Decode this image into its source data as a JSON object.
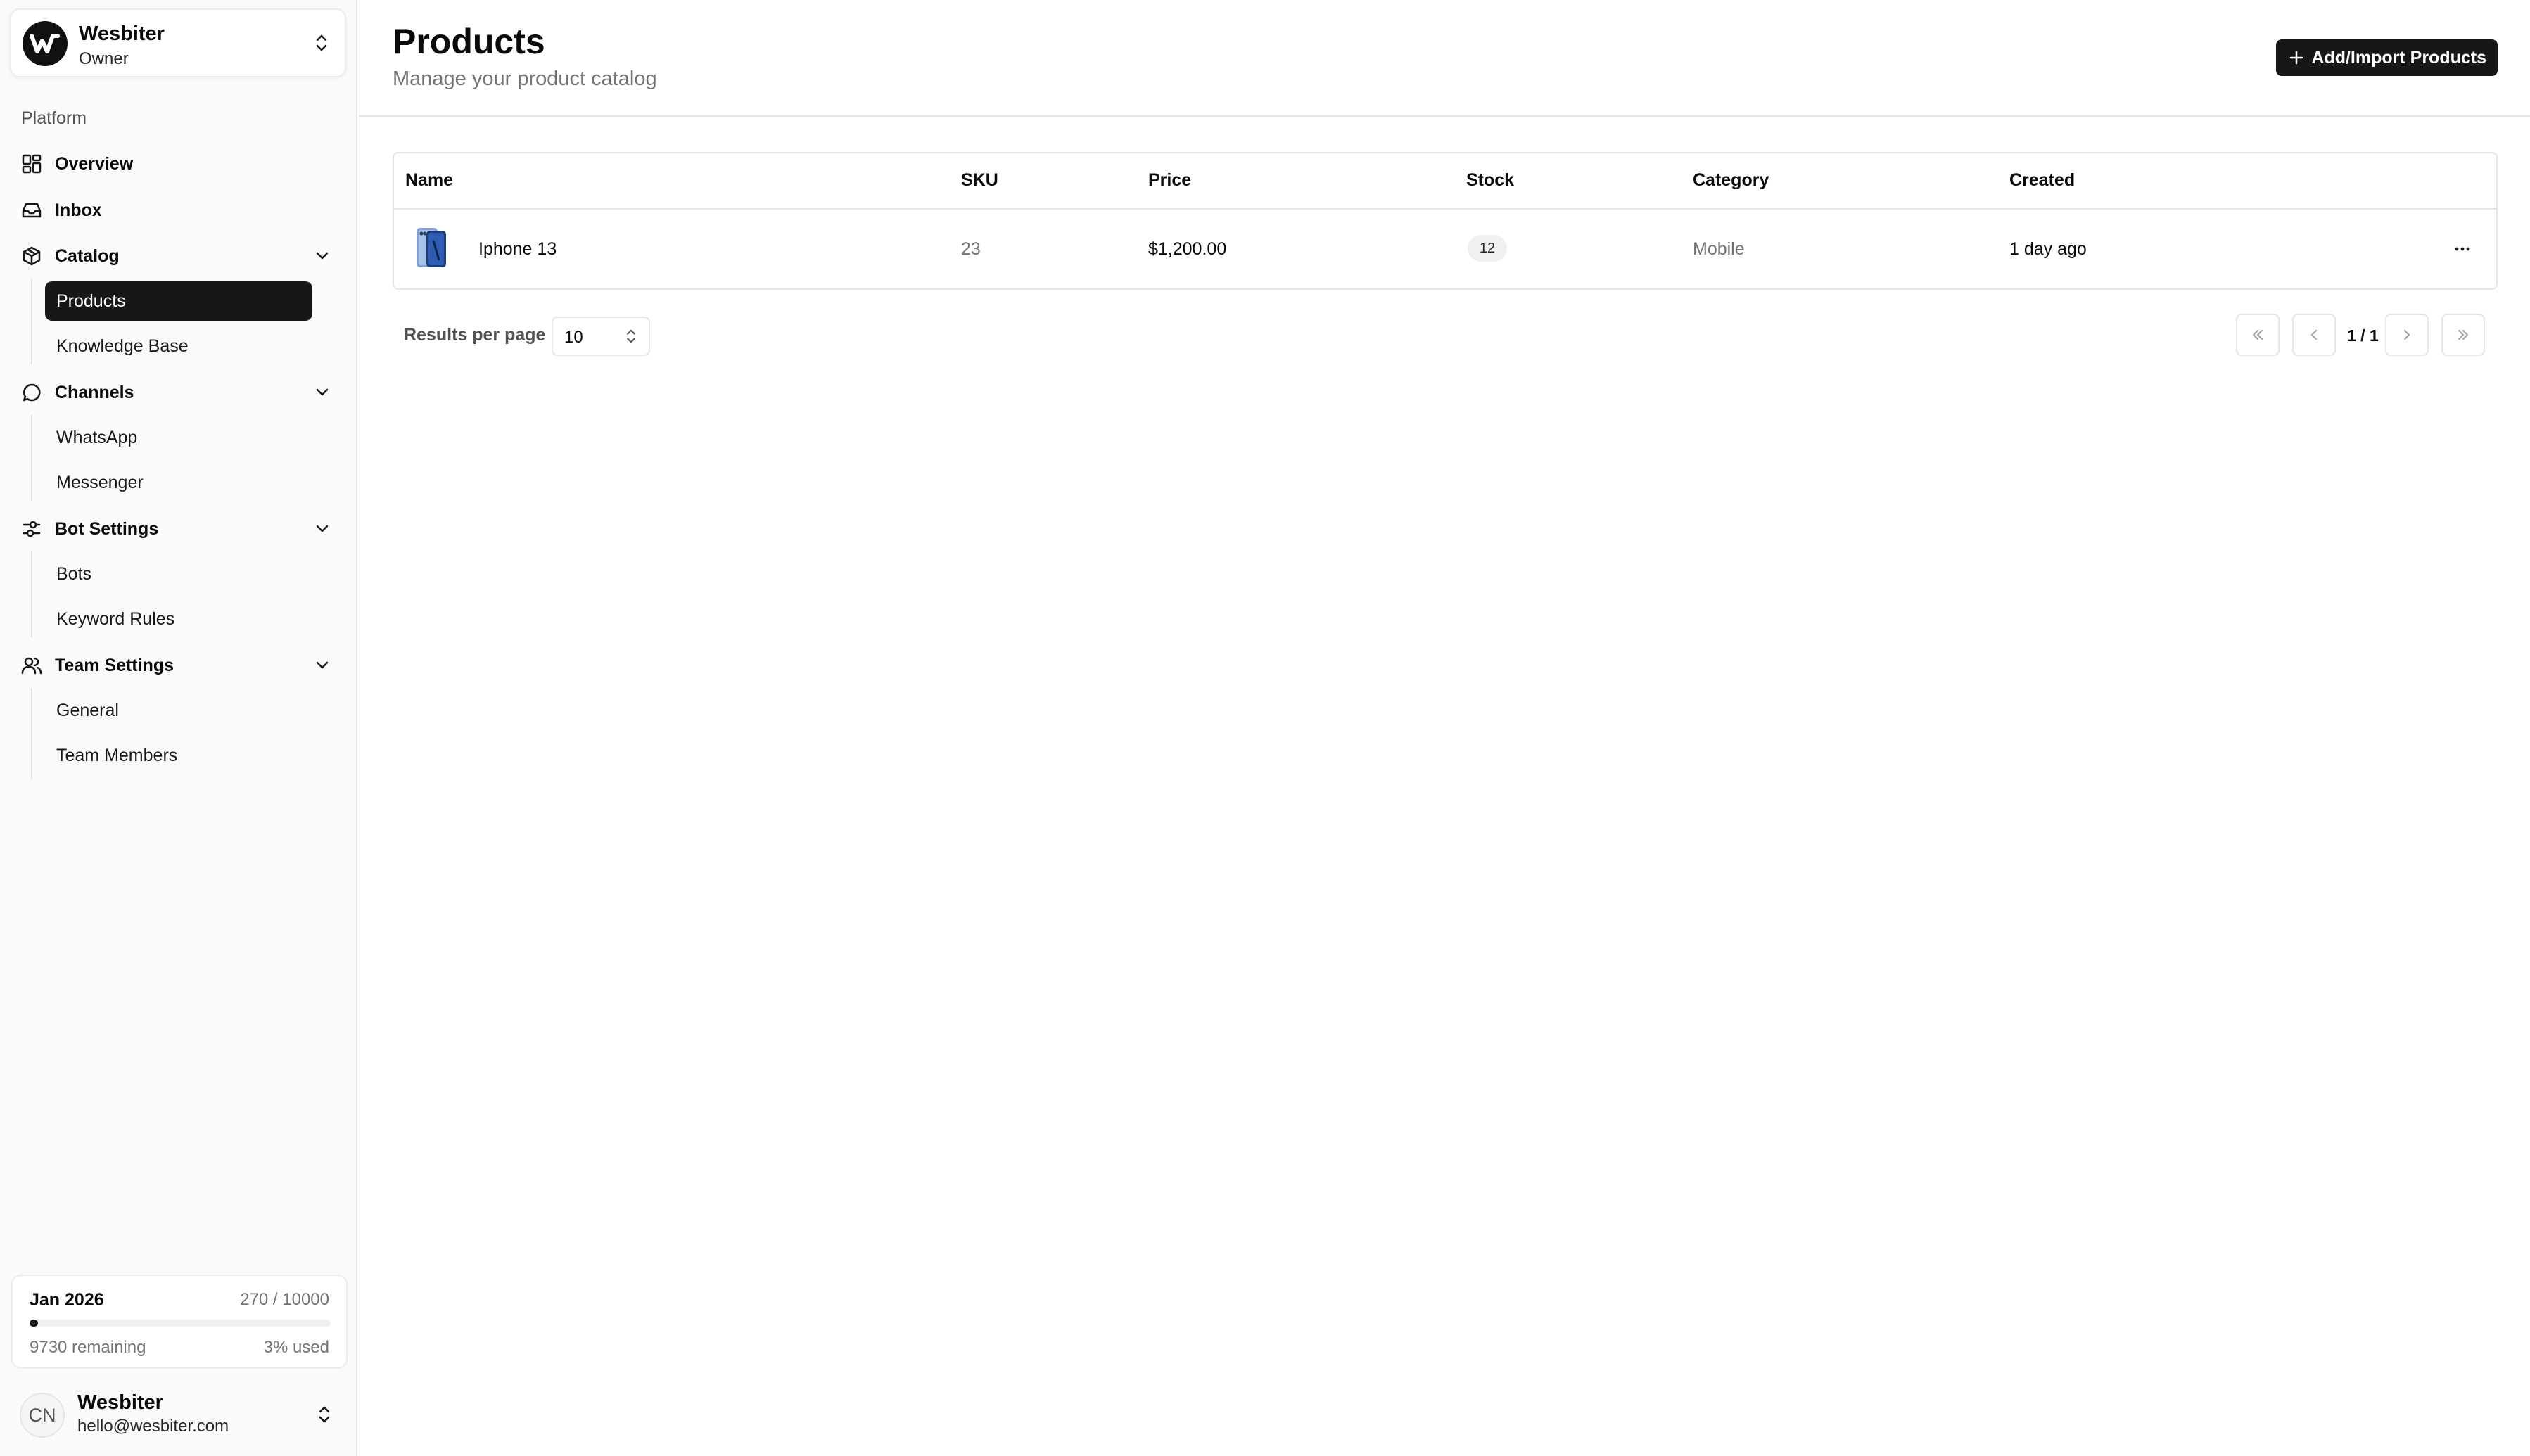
{
  "org": {
    "name": "Wesbiter",
    "role": "Owner"
  },
  "sidebar": {
    "group_label": "Platform",
    "overview": "Overview",
    "inbox": "Inbox",
    "catalog": {
      "label": "Catalog",
      "items": [
        "Products",
        "Knowledge Base"
      ],
      "active": "Products"
    },
    "channels": {
      "label": "Channels",
      "items": [
        "WhatsApp",
        "Messenger"
      ]
    },
    "bot_settings": {
      "label": "Bot Settings",
      "items": [
        "Bots",
        "Keyword Rules"
      ]
    },
    "team_settings": {
      "label": "Team Settings",
      "items": [
        "General",
        "Team Members"
      ]
    }
  },
  "usage": {
    "month": "Jan 2026",
    "count": "270 / 10000",
    "remaining": "9730 remaining",
    "percent_used": "3% used",
    "fraction": 0.027
  },
  "user": {
    "initials": "CN",
    "name": "Wesbiter",
    "email": "hello@wesbiter.com"
  },
  "page": {
    "title": "Products",
    "subtitle": "Manage your product catalog",
    "add_button": "Add/Import Products"
  },
  "table": {
    "headers": [
      "Name",
      "SKU",
      "Price",
      "Stock",
      "Category",
      "Created"
    ],
    "rows": [
      {
        "name": "Iphone 13",
        "sku": "23",
        "price": "$1,200.00",
        "stock": "12",
        "category": "Mobile",
        "created": "1 day ago"
      }
    ]
  },
  "pagination": {
    "results_per_page_label": "Results per page",
    "results_per_page": "10",
    "page_info": "1 / 1"
  },
  "colors": {
    "accent": "#171717",
    "muted": "#737373",
    "border": "#e5e5e5"
  }
}
